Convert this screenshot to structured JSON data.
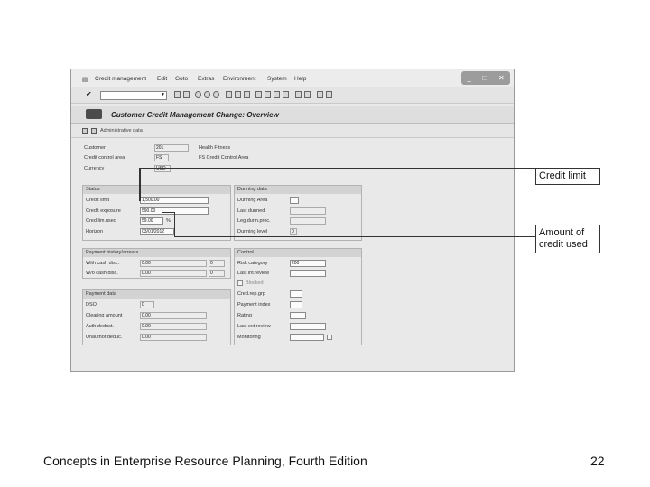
{
  "menu": {
    "items": [
      "Credit management",
      "Edit",
      "Goto",
      "Extras",
      "Environment",
      "System",
      "Help"
    ]
  },
  "window_controls": [
    "_",
    "□",
    "✕"
  ],
  "screen_title": "Customer Credit Management Change: Overview",
  "app_toolbar": {
    "admin_data_label": "Administrative data"
  },
  "header_fields": [
    {
      "label": "Customer",
      "value": "201",
      "desc": "Health Fitness"
    },
    {
      "label": "Credit control area",
      "value": "FS",
      "desc": "FS Credit Control Area"
    },
    {
      "label": "Currency",
      "value": "USD",
      "desc": ""
    }
  ],
  "status": {
    "title": "Status",
    "rows": [
      {
        "label": "Credit limit",
        "value": "1,500.00",
        "extra": ""
      },
      {
        "label": "Credit exposure",
        "value": "590.00",
        "extra": ""
      },
      {
        "label": "Cred.lim.used",
        "value": "59.00",
        "extra": "%"
      },
      {
        "label": "Horizon",
        "value": "03/01/2012",
        "extra": ""
      }
    ]
  },
  "dunning": {
    "title": "Dunning data",
    "rows": [
      {
        "label": "Dunning Area",
        "value": ""
      },
      {
        "label": "Last dunned",
        "value": ""
      },
      {
        "label": "Leg.dunn.proc.",
        "value": ""
      },
      {
        "label": "Dunning level",
        "value": "0"
      }
    ]
  },
  "payment_history": {
    "title": "Payment history/arrears",
    "rows": [
      {
        "label": "With cash disc.",
        "value": "0.00",
        "count": "0"
      },
      {
        "label": "W/o cash disc.",
        "value": "0.00",
        "count": "0"
      }
    ]
  },
  "control": {
    "title": "Control",
    "rows": [
      {
        "label": "Risk category",
        "value": "200"
      },
      {
        "label": "Last int.review",
        "value": ""
      }
    ],
    "blocked_label": "Blocked",
    "rows2": [
      {
        "label": "Cred.rep.grp",
        "value": ""
      },
      {
        "label": "Payment index",
        "value": ""
      },
      {
        "label": "Rating",
        "value": ""
      },
      {
        "label": "Last ext.review",
        "value": ""
      },
      {
        "label": "Monitoring",
        "value": ""
      }
    ]
  },
  "payment_data": {
    "title": "Payment data",
    "rows": [
      {
        "label": "DSO",
        "value": "0"
      },
      {
        "label": "Clearing amount",
        "value": "0.00"
      },
      {
        "label": "Auth.deduct.",
        "value": "0.00"
      },
      {
        "label": "Unauthor.deduc.",
        "value": "0.00"
      }
    ]
  },
  "callouts": {
    "credit_limit": "Credit limit",
    "amount_used": "Amount of credit used"
  },
  "footer": {
    "text": "Concepts in Enterprise Resource Planning, Fourth Edition",
    "page": "22"
  }
}
